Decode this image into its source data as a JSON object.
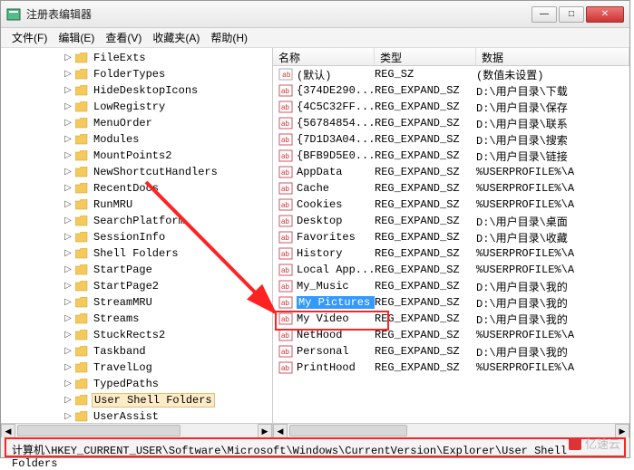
{
  "window": {
    "title": "注册表编辑器"
  },
  "winbtns": {
    "min": "—",
    "max": "□",
    "close": "✕"
  },
  "menu": [
    "文件(F)",
    "编辑(E)",
    "查看(V)",
    "收藏夹(A)",
    "帮助(H)"
  ],
  "tree": [
    {
      "label": "FileExts"
    },
    {
      "label": "FolderTypes"
    },
    {
      "label": "HideDesktopIcons"
    },
    {
      "label": "LowRegistry"
    },
    {
      "label": "MenuOrder"
    },
    {
      "label": "Modules"
    },
    {
      "label": "MountPoints2"
    },
    {
      "label": "NewShortcutHandlers"
    },
    {
      "label": "RecentDocs"
    },
    {
      "label": "RunMRU"
    },
    {
      "label": "SearchPlatform"
    },
    {
      "label": "SessionInfo"
    },
    {
      "label": "Shell Folders"
    },
    {
      "label": "StartPage"
    },
    {
      "label": "StartPage2"
    },
    {
      "label": "StreamMRU"
    },
    {
      "label": "Streams"
    },
    {
      "label": "StuckRects2"
    },
    {
      "label": "Taskband"
    },
    {
      "label": "TravelLog"
    },
    {
      "label": "TypedPaths"
    },
    {
      "label": "User Shell Folders",
      "selected": true
    },
    {
      "label": "UserAssist"
    }
  ],
  "columns": {
    "name": "名称",
    "type": "类型",
    "data": "数据"
  },
  "values": [
    {
      "name": "(默认)",
      "type": "REG_SZ",
      "data": "(数值未设置)",
      "def": true
    },
    {
      "name": "{374DE290...",
      "type": "REG_EXPAND_SZ",
      "data": "D:\\用户目录\\下载"
    },
    {
      "name": "{4C5C32FF...",
      "type": "REG_EXPAND_SZ",
      "data": "D:\\用户目录\\保存"
    },
    {
      "name": "{56784854...",
      "type": "REG_EXPAND_SZ",
      "data": "D:\\用户目录\\联系"
    },
    {
      "name": "{7D1D3A04...",
      "type": "REG_EXPAND_SZ",
      "data": "D:\\用户目录\\搜索"
    },
    {
      "name": "{BFB9D5E0...",
      "type": "REG_EXPAND_SZ",
      "data": "D:\\用户目录\\链接"
    },
    {
      "name": "AppData",
      "type": "REG_EXPAND_SZ",
      "data": "%USERPROFILE%\\A"
    },
    {
      "name": "Cache",
      "type": "REG_EXPAND_SZ",
      "data": "%USERPROFILE%\\A"
    },
    {
      "name": "Cookies",
      "type": "REG_EXPAND_SZ",
      "data": "%USERPROFILE%\\A"
    },
    {
      "name": "Desktop",
      "type": "REG_EXPAND_SZ",
      "data": "D:\\用户目录\\桌面"
    },
    {
      "name": "Favorites",
      "type": "REG_EXPAND_SZ",
      "data": "D:\\用户目录\\收藏"
    },
    {
      "name": "History",
      "type": "REG_EXPAND_SZ",
      "data": "%USERPROFILE%\\A"
    },
    {
      "name": "Local App...",
      "type": "REG_EXPAND_SZ",
      "data": "%USERPROFILE%\\A"
    },
    {
      "name": "My_Music",
      "type": "REG_EXPAND_SZ",
      "data": "D:\\用户目录\\我的"
    },
    {
      "name": "My Pictures",
      "type": "REG_EXPAND_SZ",
      "data": "D:\\用户目录\\我的",
      "selected": true
    },
    {
      "name": "My Video",
      "type": "REG_EXPAND_SZ",
      "data": "D:\\用户目录\\我的"
    },
    {
      "name": "NetHood",
      "type": "REG_EXPAND_SZ",
      "data": "%USERPROFILE%\\A"
    },
    {
      "name": "Personal",
      "type": "REG_EXPAND_SZ",
      "data": "D:\\用户目录\\我的"
    },
    {
      "name": "PrintHood",
      "type": "REG_EXPAND_SZ",
      "data": "%USERPROFILE%\\A"
    }
  ],
  "status": "计算机\\HKEY_CURRENT_USER\\Software\\Microsoft\\Windows\\CurrentVersion\\Explorer\\User Shell Folders",
  "watermark": "亿速云"
}
